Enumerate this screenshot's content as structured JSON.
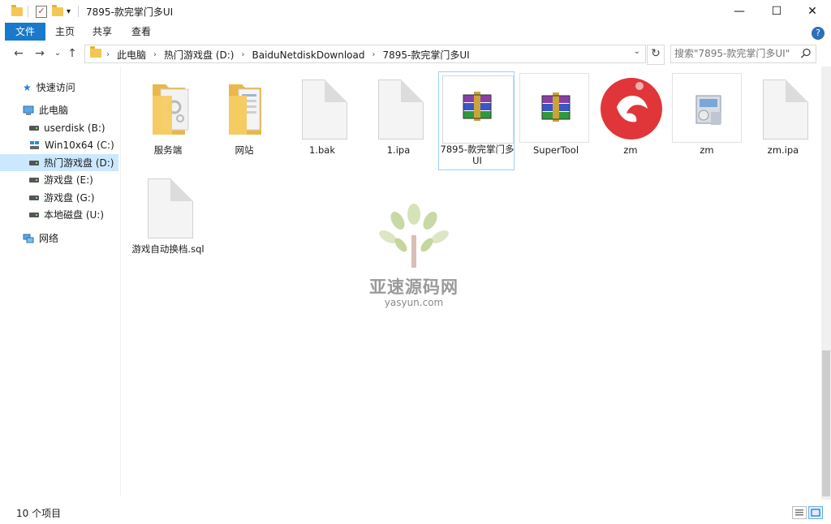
{
  "window": {
    "title": "7895-款完掌门多UI",
    "minimize": "—",
    "maximize": "☐",
    "close": "✕"
  },
  "ribbon": {
    "tabs": [
      "文件",
      "主页",
      "共享",
      "查看"
    ],
    "help": "?",
    "collapse": "⌄"
  },
  "nav": {
    "back": "←",
    "forward": "→",
    "recent": "⌄",
    "up": "↑",
    "breadcrumb": [
      "此电脑",
      "热门游戏盘 (D:)",
      "BaiduNetdiskDownload",
      "7895-款完掌门多UI"
    ],
    "dropdown": "⌄",
    "refresh": "↻"
  },
  "search": {
    "placeholder": "搜索\"7895-款完掌门多UI\""
  },
  "sidebar": {
    "quick_access": "快速访问",
    "this_pc": "此电脑",
    "drives": [
      {
        "label": "userdisk (B:)"
      },
      {
        "label": "Win10x64 (C:)"
      },
      {
        "label": "热门游戏盘 (D:)"
      },
      {
        "label": "游戏盘 (E:)"
      },
      {
        "label": "游戏盘 (G:)"
      },
      {
        "label": "本地磁盘 (U:)"
      }
    ],
    "network": "网络"
  },
  "files": [
    {
      "name": "服务端",
      "kind": "folder-settings"
    },
    {
      "name": "网站",
      "kind": "folder-doc"
    },
    {
      "name": "1.bak",
      "kind": "file"
    },
    {
      "name": "1.ipa",
      "kind": "file"
    },
    {
      "name": "7895-款完掌门多UI",
      "kind": "rar"
    },
    {
      "name": "SuperTool",
      "kind": "rar"
    },
    {
      "name": "zm",
      "kind": "app-red"
    },
    {
      "name": "zm",
      "kind": "installer"
    },
    {
      "name": "zm.ipa",
      "kind": "file"
    },
    {
      "name": "游戏自动换档.sql",
      "kind": "file"
    }
  ],
  "watermark": {
    "title": "亚速源码网",
    "subtitle": "yasyun.com"
  },
  "status": {
    "count": "10 个项目"
  },
  "colors": {
    "accent": "#1979ca",
    "selection": "#cce8ff",
    "folder": "#f3c755",
    "app_red": "#e0363a"
  }
}
